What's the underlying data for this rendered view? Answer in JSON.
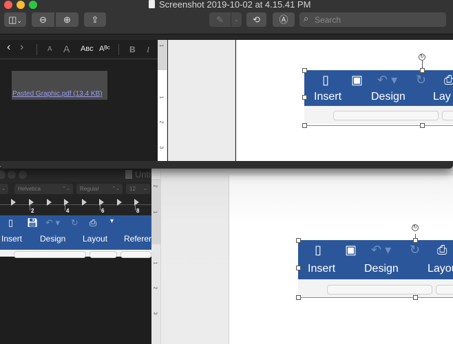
{
  "window": {
    "title": "Screenshot 2019-10-02 at 4.15.41 PM",
    "traffic_lights": {
      "close": "#fc5f57",
      "minimize": "#fdbb2e",
      "zoom": "#2ac840"
    }
  },
  "toolbar": {
    "sidebar_button_icon": "sidebar-icon",
    "zoom_out_icon": "zoom-out-icon",
    "zoom_in_icon": "zoom-in-icon",
    "share_icon": "share-icon",
    "markup_pen_icon": "pen-icon",
    "rotate_icon": "rotate-icon",
    "annotate_icon": "markup-icon",
    "search": {
      "placeholder": "Search",
      "value": ""
    }
  },
  "pasted_screenshot_1": {
    "format_bar": {
      "back": "‹",
      "forward": "›",
      "font_smaller": "A",
      "font_larger": "A",
      "small_caps": "Aʙᴄ",
      "superscript": "Aᴮᶜ",
      "bold": "B",
      "italic": "I"
    },
    "attachment_label": "Pasted Graphic.pdf (13.4 KB)",
    "ruler_numbers": [
      "1",
      "1",
      "2",
      "3"
    ],
    "embedded_ribbon": {
      "tabs": [
        "Insert",
        "Design",
        "Lay"
      ],
      "icons": [
        "sidebar-doc-icon",
        "save-icon",
        "undo-icon",
        "redo-icon",
        "print-icon"
      ]
    }
  },
  "back_window": {
    "title": "Untit",
    "font_family": "Helvetica",
    "font_style": "Regular",
    "font_size": "12",
    "ruler_numbers": [
      "2",
      "4",
      "6",
      "8"
    ],
    "ribbon_tabs": [
      "Insert",
      "Design",
      "Layout",
      "Referen"
    ],
    "vruler_numbers": [
      "2",
      "1",
      "1",
      "2",
      "3"
    ],
    "embedded_ribbon": {
      "tabs": [
        "Insert",
        "Design",
        "Layou"
      ]
    }
  },
  "colors": {
    "word_blue": "#2b579a",
    "link": "#9b9bf2"
  }
}
